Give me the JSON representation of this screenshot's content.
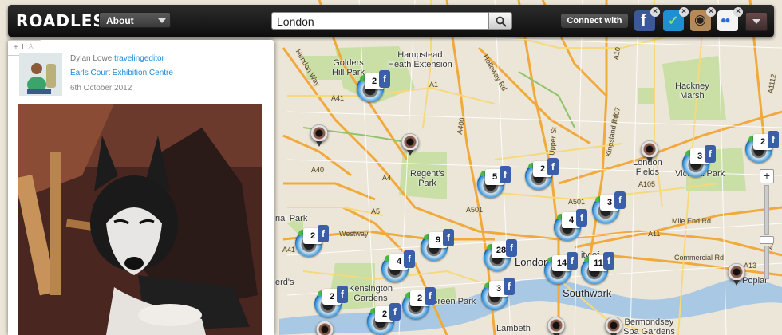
{
  "app": {
    "logo": "ROADLESS"
  },
  "header": {
    "about_label": "About",
    "search_value": "London",
    "connect_label": "Connect with",
    "social": [
      {
        "name": "facebook",
        "glyph": "f",
        "color": "#3b5998"
      },
      {
        "name": "foursquare",
        "glyph": "✓",
        "color": "#1e8fd0"
      },
      {
        "name": "instagram",
        "glyph": "◉",
        "color": "#b58a5b"
      },
      {
        "name": "flickr",
        "glyph": "●●",
        "color": "#2d6bd6"
      }
    ]
  },
  "post": {
    "plus_count": "+ 1",
    "user_name": "Dylan Lowe",
    "user_handle": "travelingeditor",
    "place": "Earls Court Exhibition Centre",
    "date": "6th October 2012"
  },
  "map": {
    "places": [
      {
        "id": "golders",
        "text": "Golders\nHill Park"
      },
      {
        "id": "hampstead",
        "text": "Hampstead\nHeath Extension"
      },
      {
        "id": "hackney",
        "text": "Hackney\nMarsh"
      },
      {
        "id": "regents",
        "text": "Regent's\nPark"
      },
      {
        "id": "londonfields",
        "text": "London\nFields"
      },
      {
        "id": "victoriapark",
        "text": "Victoria Park"
      },
      {
        "id": "kensington",
        "text": "Kensington\nGardens"
      },
      {
        "id": "greenpark",
        "text": "Green Park"
      },
      {
        "id": "london",
        "text": "London"
      },
      {
        "id": "southwark",
        "text": "Southwark"
      },
      {
        "id": "lambeth",
        "text": "Lambeth"
      },
      {
        "id": "bermondsey",
        "text": "Bermondsey\nSpa Gardens"
      },
      {
        "id": "poplar",
        "text": "Poplar"
      },
      {
        "id": "parkleft",
        "text": "rial Park"
      },
      {
        "id": "herds",
        "text": "erd's"
      },
      {
        "id": "ofy",
        "text": "ity of"
      }
    ],
    "roads": [
      "Hendon Way",
      "A41",
      "A1",
      "A400",
      "Holloway Rd",
      "A10",
      "A1112",
      "Upper St",
      "Kingsland Rd",
      "A107",
      "A501",
      "A5",
      "A4",
      "Westway",
      "A41",
      "A11",
      "Mile End Rd",
      "Commercial Rd",
      "A13",
      "A12",
      "A40",
      "A501",
      "A105"
    ],
    "clusters": [
      "2",
      "5",
      "2",
      "3",
      "4",
      "2",
      "9",
      "28",
      "4",
      "14",
      "11",
      "2",
      "2",
      "3",
      "2",
      "3",
      "2"
    ]
  }
}
